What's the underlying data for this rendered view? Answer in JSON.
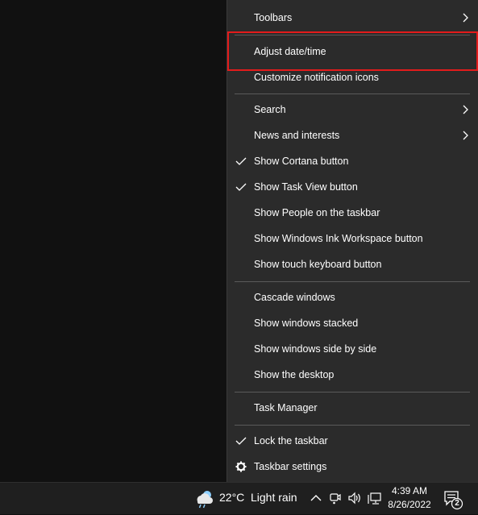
{
  "context_menu": {
    "items": [
      {
        "label": "Toolbars",
        "checked": false,
        "submenu": true
      },
      {
        "label": "Adjust date/time",
        "checked": false,
        "submenu": false,
        "highlighted": true
      },
      {
        "label": "Customize notification icons",
        "checked": false,
        "submenu": false
      },
      {
        "label": "Search",
        "checked": false,
        "submenu": true
      },
      {
        "label": "News and interests",
        "checked": false,
        "submenu": true
      },
      {
        "label": "Show Cortana button",
        "checked": true,
        "submenu": false
      },
      {
        "label": "Show Task View button",
        "checked": true,
        "submenu": false
      },
      {
        "label": "Show People on the taskbar",
        "checked": false,
        "submenu": false
      },
      {
        "label": "Show Windows Ink Workspace button",
        "checked": false,
        "submenu": false
      },
      {
        "label": "Show touch keyboard button",
        "checked": false,
        "submenu": false
      },
      {
        "label": "Cascade windows",
        "checked": false,
        "submenu": false
      },
      {
        "label": "Show windows stacked",
        "checked": false,
        "submenu": false
      },
      {
        "label": "Show windows side by side",
        "checked": false,
        "submenu": false
      },
      {
        "label": "Show the desktop",
        "checked": false,
        "submenu": false
      },
      {
        "label": "Task Manager",
        "checked": false,
        "submenu": false
      },
      {
        "label": "Lock the taskbar",
        "checked": true,
        "submenu": false
      },
      {
        "label": "Taskbar settings",
        "checked": false,
        "submenu": false,
        "icon": "gear-icon"
      }
    ],
    "highlight_color": "#e31b1b"
  },
  "taskbar": {
    "weather": {
      "icon": "cloud-rain-icon",
      "temperature": "22°C",
      "condition": "Light rain"
    },
    "tray_icons": [
      "chevron-up-icon",
      "meet-now-icon",
      "volume-icon",
      "network-icon"
    ],
    "clock": {
      "time": "4:39 AM",
      "date": "8/26/2022"
    },
    "notifications": {
      "icon": "action-center-icon",
      "count": "2"
    }
  }
}
